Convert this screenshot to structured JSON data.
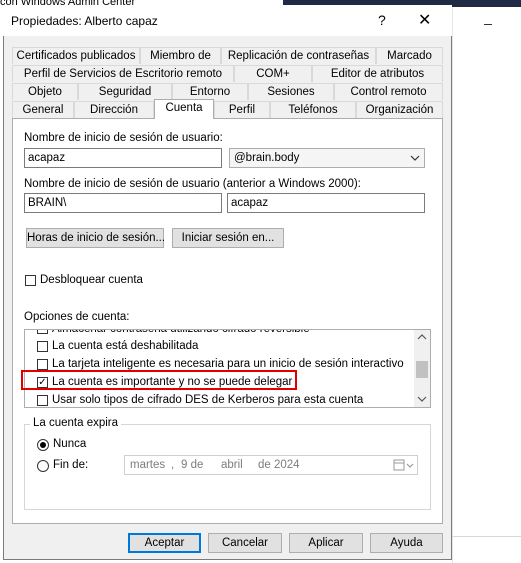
{
  "background": {
    "window_title": "con Windows Admin Center"
  },
  "dialog": {
    "title": "Propiedades: Alberto capaz",
    "help_glyph": "?",
    "close_glyph": "✕"
  },
  "tabs": {
    "row1": [
      "Certificados publicados",
      "Miembro de",
      "Replicación de contraseñas",
      "Marcado"
    ],
    "row2": [
      "Perfil de Servicios de Escritorio remoto",
      "COM+",
      "Editor de atributos"
    ],
    "row3": [
      "Objeto",
      "Seguridad",
      "Entorno",
      "Sesiones",
      "Control remoto"
    ],
    "row4": [
      "General",
      "Dirección",
      "Cuenta",
      "Perfil",
      "Teléfonos",
      "Organización"
    ],
    "active": "Cuenta"
  },
  "account": {
    "logon_label": "Nombre de inicio de sesión de usuario:",
    "logon_value": "acapaz",
    "domain_value": "@brain.body",
    "pre2000_label": "Nombre de inicio de sesión de usuario (anterior a Windows 2000):",
    "pre2000_domain": "BRAIN\\",
    "pre2000_value": "acapaz",
    "logon_hours_button": "Horas de inicio de sesión...",
    "logon_to_button": "Iniciar sesión en...",
    "unlock_label": "Desbloquear cuenta",
    "options_label": "Opciones de cuenta:",
    "options": [
      {
        "label": "Almacenar contraseña utilizando cifrado reversible",
        "checked": false
      },
      {
        "label": "La cuenta está deshabilitada",
        "checked": false
      },
      {
        "label": "La tarjeta inteligente es necesaria para un inicio de sesión interactivo",
        "checked": false
      },
      {
        "label": "La cuenta es importante y no se puede delegar",
        "checked": true
      },
      {
        "label": "Usar solo tipos de cifrado DES de Kerberos para esta cuenta",
        "checked": false
      }
    ],
    "expires_label": "La cuenta expira",
    "never_label": "Nunca",
    "end_label": "Fin de:",
    "date": {
      "weekday": "martes",
      "sep": ",",
      "day": "9 de",
      "month": "abril",
      "year": "de 2024"
    },
    "selected_expiry": "Nunca"
  },
  "buttons": {
    "ok": "Aceptar",
    "cancel": "Cancelar",
    "apply": "Aplicar",
    "help": "Ayuda"
  },
  "colors": {
    "highlight": "#e00000",
    "default_button_border": "#0078d7"
  }
}
